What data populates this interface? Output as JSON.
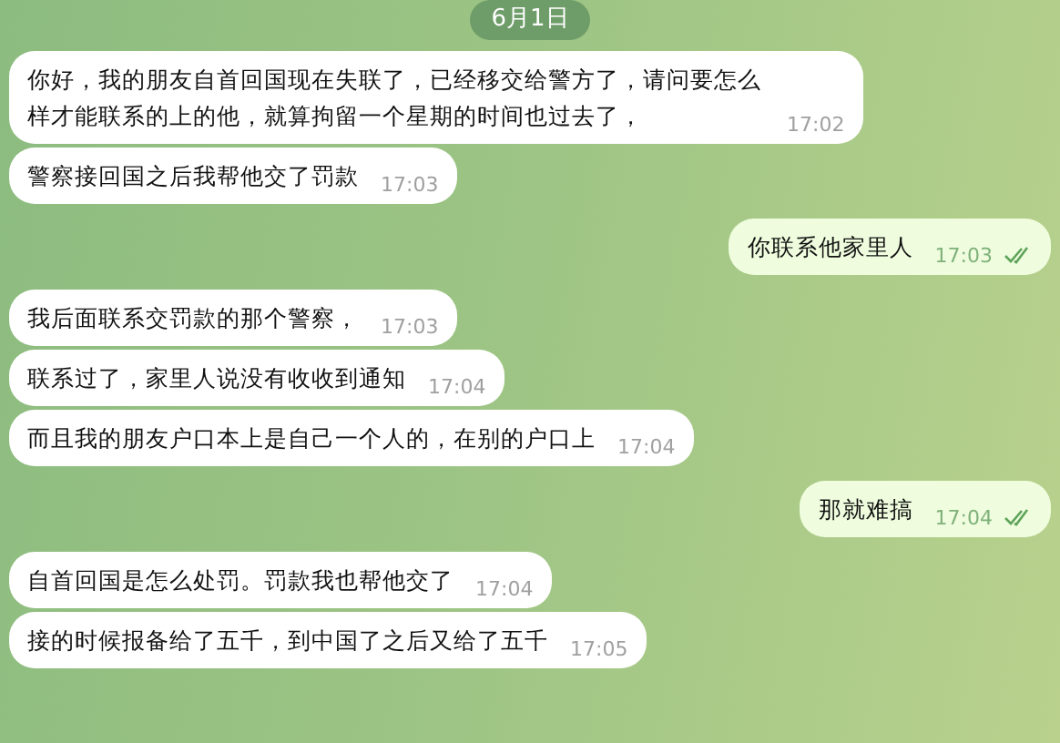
{
  "date_badge": "6月1日",
  "messages": [
    {
      "outgoing": false,
      "text": "你好，我的朋友自首回国现在失联了，已经移交给警方了，请问要怎么样才能联系的上的他，就算拘留一个星期的时间也过去了，",
      "time": "17:02"
    },
    {
      "outgoing": false,
      "text": "警察接回国之后我帮他交了罚款",
      "time": "17:03"
    },
    {
      "outgoing": true,
      "text": "你联系他家里人",
      "time": "17:03",
      "read": true
    },
    {
      "outgoing": false,
      "text": "我后面联系交罚款的那个警察，",
      "time": "17:03"
    },
    {
      "outgoing": false,
      "text": "联系过了，家里人说没有收收到通知",
      "time": "17:04"
    },
    {
      "outgoing": false,
      "text": "而且我的朋友户口本上是自己一个人的，在别的户口上",
      "time": "17:04"
    },
    {
      "outgoing": true,
      "text": "那就难搞",
      "time": "17:04",
      "read": true
    },
    {
      "outgoing": false,
      "text": "自首回国是怎么处罚。罚款我也帮他交了",
      "time": "17:04"
    },
    {
      "outgoing": false,
      "text": "接的时候报备给了五千，到中国了之后又给了五千",
      "time": "17:05"
    }
  ]
}
